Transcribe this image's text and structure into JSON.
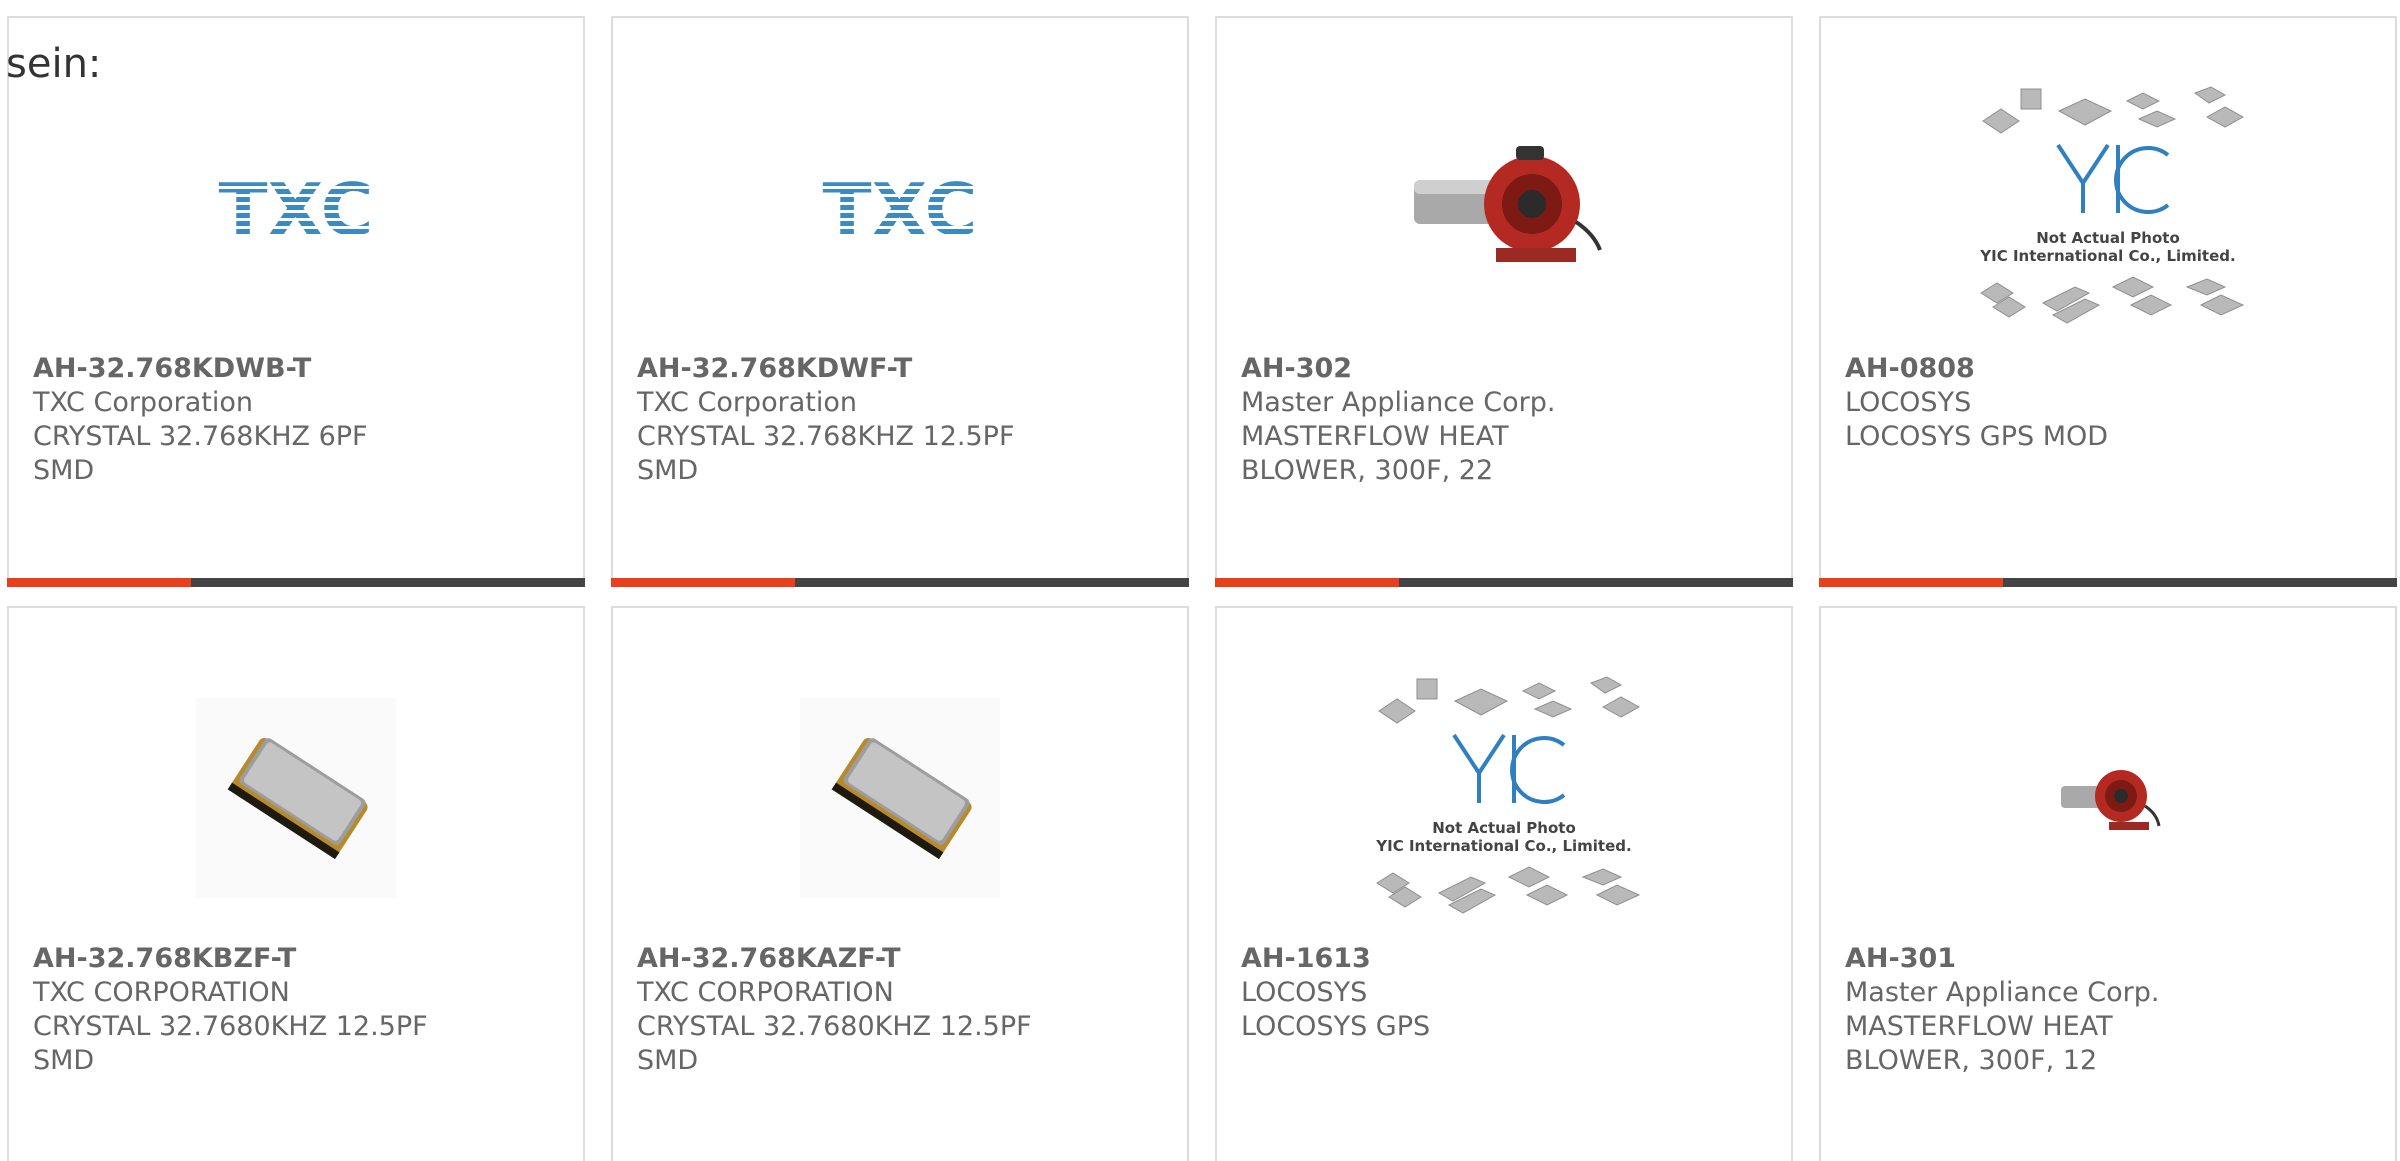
{
  "page": {
    "fragment_text": "sein:"
  },
  "colors": {
    "accent": "#e8401c",
    "bar": "#444444",
    "text": "#666666",
    "border": "#dcdcdc"
  },
  "products": [
    {
      "part_number": "AH-32.768KDWB-T",
      "manufacturer": "TXC Corporation",
      "description": "CRYSTAL 32.768KHZ 6PF SMD",
      "image": "txc-logo",
      "logo_text": "TXC"
    },
    {
      "part_number": "AH-32.768KDWF-T",
      "manufacturer": "TXC Corporation",
      "description": "CRYSTAL 32.768KHZ 12.5PF SMD",
      "image": "txc-logo",
      "logo_text": "TXC"
    },
    {
      "part_number": "AH-302",
      "manufacturer": "Master Appliance Corp.",
      "description": "MASTERFLOW HEAT BLOWER, 300F, 22",
      "image": "heat-blower-photo"
    },
    {
      "part_number": "AH-0808",
      "manufacturer": "LOCOSYS",
      "description": "LOCOSYS GPS MOD",
      "image": "yic-placeholder",
      "placeholder_line1": "Not Actual Photo",
      "placeholder_line2": "YIC International Co., Limited."
    },
    {
      "part_number": "AH-32.768KBZF-T",
      "manufacturer": "TXC CORPORATION",
      "description": "CRYSTAL 32.7680KHZ 12.5PF SMD",
      "image": "crystal-photo"
    },
    {
      "part_number": "AH-32.768KAZF-T",
      "manufacturer": "TXC CORPORATION",
      "description": "CRYSTAL 32.7680KHZ 12.5PF SMD",
      "image": "crystal-photo"
    },
    {
      "part_number": "AH-1613",
      "manufacturer": "LOCOSYS",
      "description": "LOCOSYS GPS",
      "image": "yic-placeholder",
      "placeholder_line1": "Not Actual Photo",
      "placeholder_line2": "YIC International Co., Limited."
    },
    {
      "part_number": "AH-301",
      "manufacturer": "Master Appliance Corp.",
      "description": "MASTERFLOW HEAT BLOWER, 300F, 12",
      "image": "heat-blower-photo-small"
    }
  ]
}
